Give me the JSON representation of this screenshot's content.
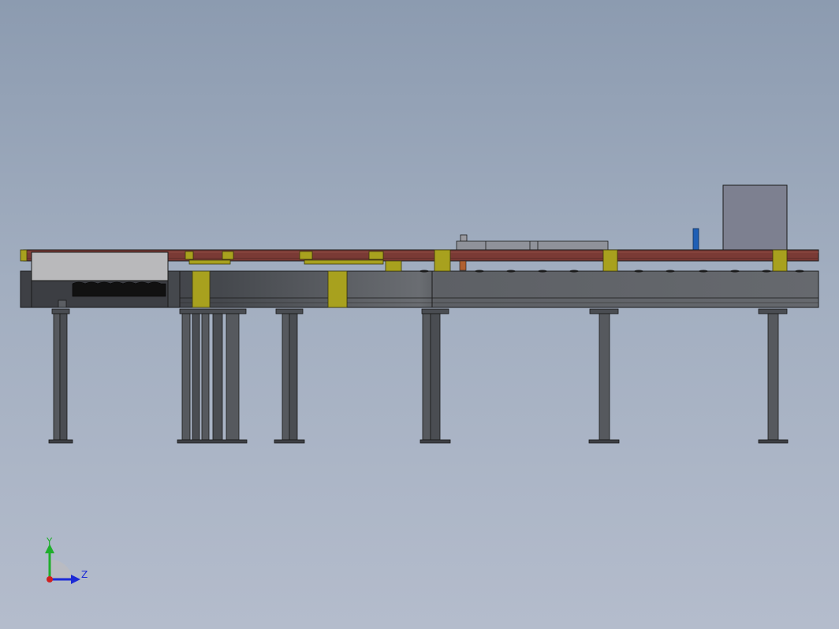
{
  "view": {
    "background_top": "#8c9bb0",
    "background_bottom": "#b4bccc"
  },
  "colors": {
    "frame_dark": "#3e4045",
    "frame_mid": "#5b5e63",
    "frame_light": "#6f7276",
    "rail_red": "#7a3a35",
    "bracket_yellow": "#a8a11e",
    "sensor_blue": "#1f5fb5",
    "cabinet_gray": "#7d8090",
    "panel_light": "#b9b9bb",
    "outline": "#1a1a1a"
  },
  "triad": {
    "y_label": "Y",
    "z_label": "Z",
    "y_color": "#1fae2c",
    "z_color": "#1c2ad6",
    "origin_color": "#d02020"
  }
}
